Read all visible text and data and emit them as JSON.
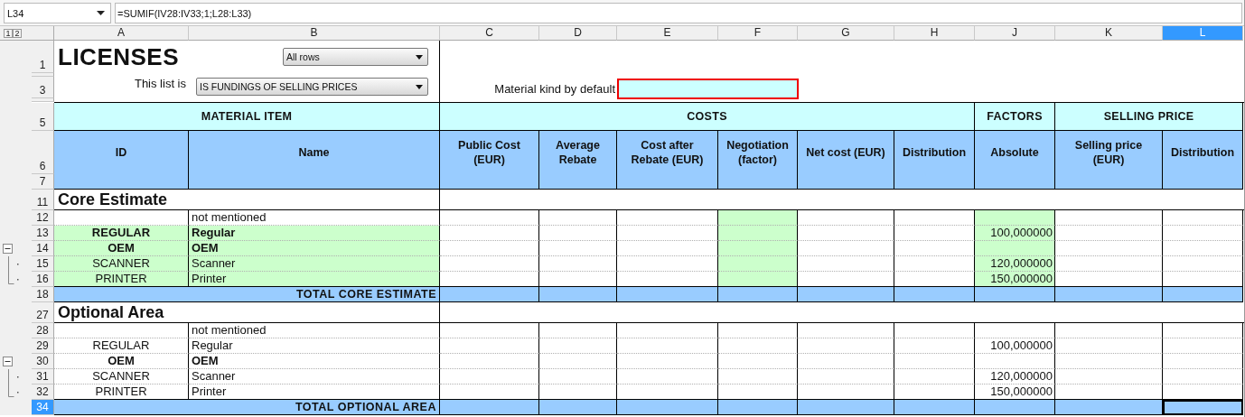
{
  "name_box": {
    "value": "L34"
  },
  "formula": {
    "value": "=SUMIF(IV28:IV33;1;L28:L33)"
  },
  "outline_levels": [
    "1",
    "2"
  ],
  "columns": [
    {
      "letter": "A",
      "selected": false
    },
    {
      "letter": "B",
      "selected": false
    },
    {
      "letter": "C",
      "selected": false
    },
    {
      "letter": "D",
      "selected": false
    },
    {
      "letter": "E",
      "selected": false
    },
    {
      "letter": "F",
      "selected": false
    },
    {
      "letter": "G",
      "selected": false
    },
    {
      "letter": "H",
      "selected": false
    },
    {
      "letter": "J",
      "selected": false
    },
    {
      "letter": "K",
      "selected": false
    },
    {
      "letter": "L",
      "selected": true
    }
  ],
  "header_rows": [
    {
      "number": "1"
    },
    {},
    {
      "number": "3"
    },
    {}
  ],
  "title": "LICENSES",
  "row_filter": {
    "value": "All rows"
  },
  "list_type": {
    "label": "This list is",
    "value": "IS FUNDINGS OF SELLING PRICES"
  },
  "material_kind": {
    "label": "Material kind by default",
    "invalid": true
  },
  "group_row": "5",
  "groups": [
    {
      "label": "MATERIAL ITEM",
      "columns": [
        "ID",
        "Name"
      ]
    },
    {
      "label": "COSTS",
      "columns": [
        "Public Cost (EUR)",
        "Average Rebate",
        "Cost after Rebate (EUR)",
        "Negotiation (factor)",
        "Net cost (EUR)",
        "Distribution"
      ]
    },
    {
      "label": "FACTORS",
      "columns": [
        "Absolute"
      ]
    },
    {
      "label": "SELLING PRICE",
      "columns": [
        "Selling price (EUR)",
        "Distribution"
      ]
    }
  ],
  "column_header_rows": [
    "6",
    "7"
  ],
  "sections": [
    {
      "title_row": "11",
      "title": "Core Estimate",
      "rows": [
        {
          "number": "12",
          "kind": "plain",
          "name": "not mentioned",
          "bold": false,
          "highlighted": false,
          "input_highlighted": true
        },
        {
          "number": "13",
          "kind": "plain",
          "id": "REGULAR",
          "name": "Regular",
          "bold": true,
          "highlighted": true,
          "input_highlighted": true,
          "factor": "100,000000"
        },
        {
          "number": "14",
          "kind": "group_toggle",
          "id": "OEM",
          "name": "OEM",
          "bold": true,
          "highlighted": true,
          "input_highlighted": true,
          "expanded": true
        },
        {
          "number": "15",
          "kind": "group_member",
          "id": "SCANNER",
          "name": "Scanner",
          "bold": false,
          "highlighted": true,
          "input_highlighted": true,
          "factor": "120,000000"
        },
        {
          "number": "16",
          "kind": "group_member",
          "id": "PRINTER",
          "name": "Printer",
          "bold": false,
          "highlighted": true,
          "input_highlighted": true,
          "factor": "150,000000"
        }
      ],
      "total": {
        "number": "18",
        "label": "TOTAL CORE ESTIMATE",
        "selected": false
      }
    },
    {
      "title_row": "27",
      "title": "Optional Area",
      "rows": [
        {
          "number": "28",
          "kind": "plain",
          "name": "not mentioned",
          "bold": false,
          "highlighted": false,
          "input_highlighted": false
        },
        {
          "number": "29",
          "kind": "plain",
          "id": "REGULAR",
          "name": "Regular",
          "bold": false,
          "highlighted": false,
          "input_highlighted": false,
          "factor": "100,000000"
        },
        {
          "number": "30",
          "kind": "group_toggle",
          "id": "OEM",
          "name": "OEM",
          "bold": true,
          "highlighted": false,
          "input_highlighted": false,
          "expanded": true
        },
        {
          "number": "31",
          "kind": "group_member",
          "id": "SCANNER",
          "name": "Scanner",
          "bold": false,
          "highlighted": false,
          "input_highlighted": false,
          "factor": "120,000000"
        },
        {
          "number": "32",
          "kind": "group_member",
          "id": "PRINTER",
          "name": "Printer",
          "bold": false,
          "highlighted": false,
          "input_highlighted": false,
          "factor": "150,000000"
        }
      ],
      "total": {
        "number": "34",
        "label": "TOTAL OPTIONAL AREA",
        "selected": true
      }
    }
  ]
}
